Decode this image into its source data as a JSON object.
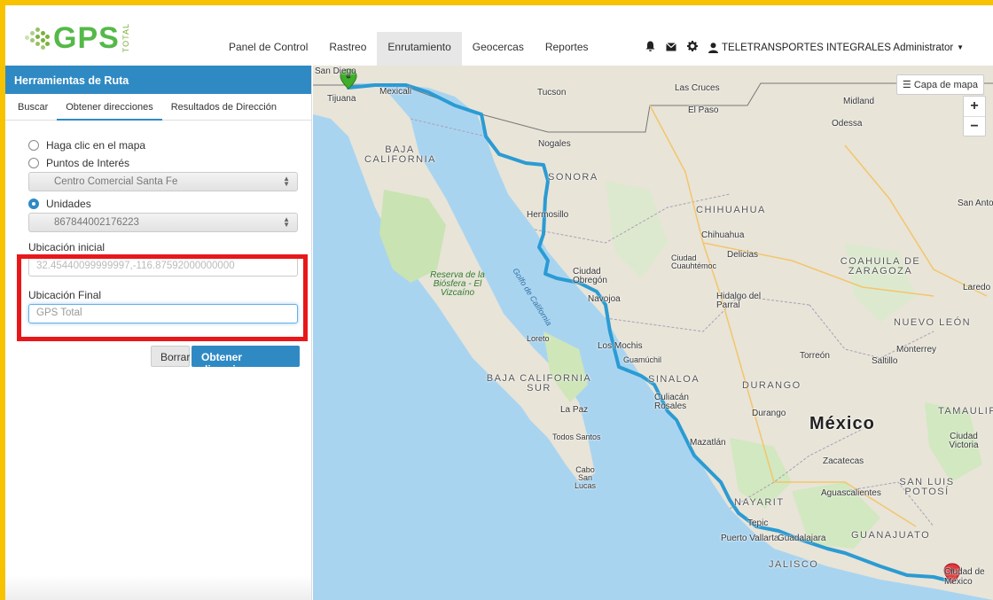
{
  "navbar": {
    "logo_text": "GPS",
    "logo_sub": "TOTAL",
    "items": [
      "Panel de Control",
      "Rastreo",
      "Enrutamiento",
      "Geocercas",
      "Reportes"
    ],
    "active_item": "Enrutamiento",
    "icons": [
      "bell-icon",
      "envelope-icon",
      "gear-icon",
      "user-icon"
    ],
    "user_label": "TELETRANSPORTES INTEGRALES Administrator"
  },
  "sidebar": {
    "title": "Herramientas de Ruta",
    "tabs": [
      "Buscar",
      "Obtener direcciones",
      "Resultados de Dirección"
    ],
    "active_tab": "Obtener direcciones",
    "options": {
      "click_map": "Haga clic en el mapa",
      "poi": "Puntos de Interés",
      "poi_select": "Centro Comercial Santa Fe",
      "units": "Unidades",
      "units_select": "867844002176223",
      "selected": "Unidades"
    },
    "start_label": "Ubicación inicial",
    "start_value": "32.45440099999997,-116.87592000000000",
    "end_label": "Ubicación Final",
    "end_value": "GPS Total",
    "clear_button": "Borrar",
    "submit_button": "Obtener direcciones"
  },
  "map": {
    "layer_button": "Capa de mapa",
    "zoom_in": "+",
    "zoom_out": "−",
    "country": "México",
    "cities": [
      "San Diego",
      "Tijuana",
      "Mexicali",
      "Tucson",
      "Las Cruces",
      "El Paso",
      "Midland",
      "Odessa",
      "Nogales",
      "Hermosillo",
      "Chihuahua",
      "Ciudad Cuauhtémoc",
      "Delicias",
      "San Antonio",
      "Laredo",
      "Ciudad Obregón",
      "Navojoa",
      "Hidalgo del Parral",
      "Los Mochis",
      "Guamúchil",
      "Loreto",
      "La Paz",
      "Todos Santos",
      "Cabo San Lucas",
      "Culiacán Rosales",
      "Torreón",
      "Saltillo",
      "Monterrey",
      "Durango",
      "Mazatlán",
      "Zacatecas",
      "Ciudad Victoria",
      "Aguascalientes",
      "Tepic",
      "Puerto Vallarta",
      "Guadalajara",
      "Ciudad de México"
    ],
    "states": [
      "BAJA CALIFORNIA",
      "SONORA",
      "CHIHUAHUA",
      "COAHUILA DE ZARAGOZA",
      "NUEVO LEÓN",
      "BAJA CALIFORNIA SUR",
      "SINALOA",
      "DURANGO",
      "TAMAULIPAS",
      "SAN LUIS POTOSÍ",
      "NAYARIT",
      "JALISCO",
      "GUANAJUATO"
    ],
    "water": "Golfo de California",
    "park": "Reserva de la Biósfera - El Vizcaíno",
    "route_color": "#2b9bd3"
  }
}
